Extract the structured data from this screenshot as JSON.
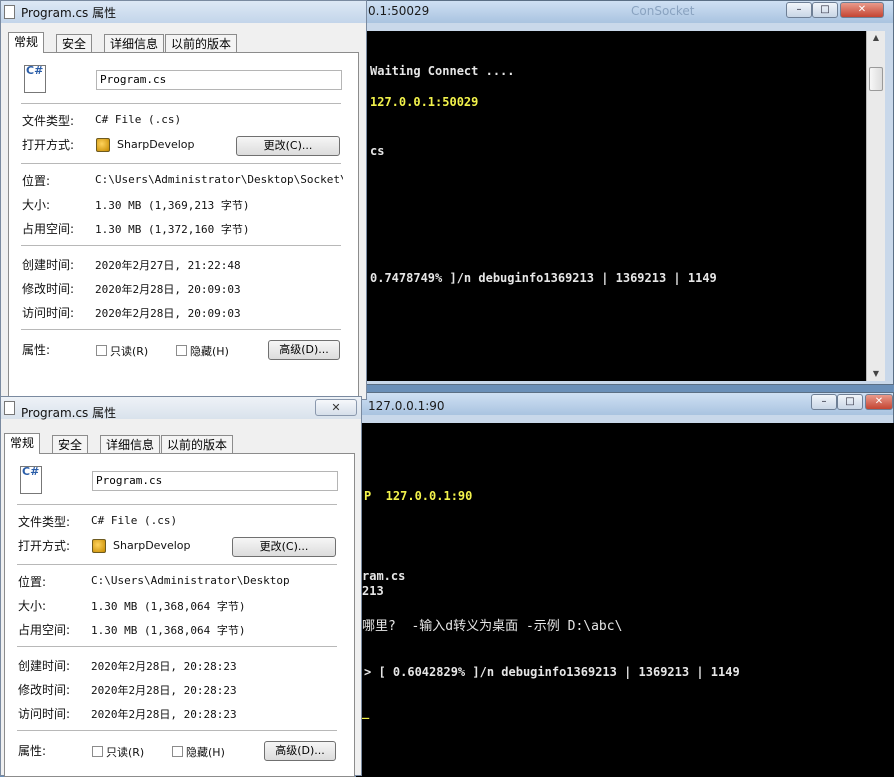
{
  "console_top": {
    "title": "0.1:50029",
    "title_faint": "ConSocket",
    "lines": [
      {
        "text": "Waiting Connect ....",
        "color": "white"
      },
      {
        "text": "127.0.0.1:50029",
        "color": "yellow"
      },
      {
        "text": "cs",
        "color": "white"
      },
      {
        "text": "0.7478749% ]/n debuginfo1369213 | 1369213 | 1149",
        "color": "white"
      }
    ],
    "buttons": {
      "minimize": "–",
      "maximize": "□",
      "close": "✕"
    }
  },
  "console_bottom": {
    "title": "127.0.0.1:90",
    "lines": [
      {
        "text": "P  127.0.0.1:90",
        "color": "yellow"
      },
      {
        "text": "ram.cs",
        "color": "white"
      },
      {
        "text": "213",
        "color": "white"
      },
      {
        "text": "哪里?  -输入d转义为桌面 -示例 D:\\abc\\",
        "color": "white"
      },
      {
        "text": "> [ 0.6042829% ]/n debuginfo1369213 | 1369213 | 1149",
        "color": "white"
      },
      {
        "text": "_",
        "color": "yellow"
      }
    ],
    "buttons": {
      "minimize": "–",
      "maximize": "□",
      "close": "✕"
    }
  },
  "dialog_top": {
    "title": "Program.cs 属性",
    "tabs": [
      "常规",
      "安全",
      "详细信息",
      "以前的版本"
    ],
    "filename": "Program.cs",
    "file_type_label": "文件类型:",
    "file_type": "C# File (.cs)",
    "open_with_label": "打开方式:",
    "open_with": "SharpDevelop",
    "change_button": "更改(C)...",
    "location_label": "位置:",
    "location": "C:\\Users\\Administrator\\Desktop\\Socket\\bac",
    "size_label": "大小:",
    "size": "1.30 MB (1,369,213 字节)",
    "disk_size_label": "占用空间:",
    "disk_size": "1.30 MB (1,372,160 字节)",
    "created_label": "创建时间:",
    "created": "2020年2月27日, 21:22:48",
    "modified_label": "修改时间:",
    "modified": "2020年2月28日, 20:09:03",
    "accessed_label": "访问时间:",
    "accessed": "2020年2月28日, 20:09:03",
    "attributes_label": "属性:",
    "readonly": "只读(R)",
    "hidden": "隐藏(H)",
    "advanced_button": "高级(D)..."
  },
  "dialog_bottom": {
    "title": "Program.cs 属性",
    "close": "✕",
    "tabs": [
      "常规",
      "安全",
      "详细信息",
      "以前的版本"
    ],
    "filename": "Program.cs",
    "file_type_label": "文件类型:",
    "file_type": "C# File (.cs)",
    "open_with_label": "打开方式:",
    "open_with": "SharpDevelop",
    "change_button": "更改(C)...",
    "location_label": "位置:",
    "location": "C:\\Users\\Administrator\\Desktop",
    "size_label": "大小:",
    "size": "1.30 MB (1,368,064 字节)",
    "disk_size_label": "占用空间:",
    "disk_size": "1.30 MB (1,368,064 字节)",
    "created_label": "创建时间:",
    "created": "2020年2月28日, 20:28:23",
    "modified_label": "修改时间:",
    "modified": "2020年2月28日, 20:28:23",
    "accessed_label": "访问时间:",
    "accessed": "2020年2月28日, 20:28:23",
    "attributes_label": "属性:",
    "readonly": "只读(R)",
    "hidden": "隐藏(H)",
    "advanced_button": "高级(D)..."
  },
  "icons": {
    "file_icon": "C#",
    "open_with_icon": "sharpdevelop-icon"
  }
}
